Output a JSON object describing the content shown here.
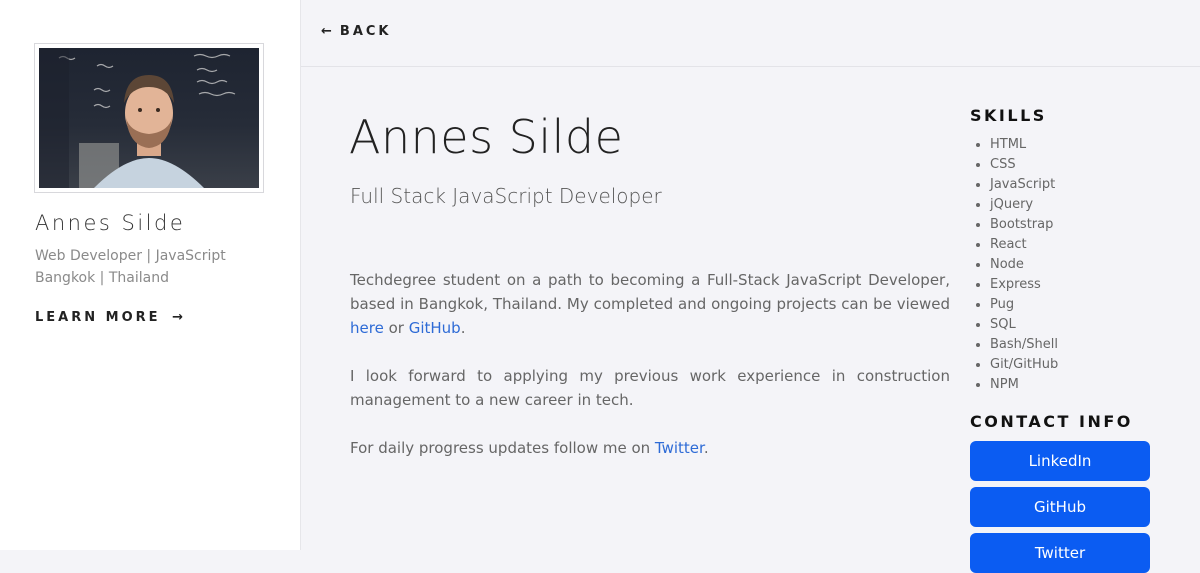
{
  "sidebar": {
    "name": "Annes Silde",
    "role": "Web Developer | JavaScript",
    "location": "Bangkok | Thailand",
    "learn_more_label": "LEARN MORE",
    "learn_more_arrow": "→"
  },
  "topbar": {
    "back_arrow": "←",
    "back_label": "BACK"
  },
  "main": {
    "name": "Annes Silde",
    "title": "Full Stack JavaScript Developer",
    "bio1_text": "Techdegree student on a path to becoming a Full-Stack JavaScript Developer, based in Bangkok, Thailand. My completed and ongoing projects can be viewed ",
    "bio1_link1": "here",
    "bio1_mid": " or ",
    "bio1_link2": "GitHub",
    "bio1_end": ".",
    "bio2_text": "I look forward to applying my previous work experience in construction management to a new career in tech.",
    "bio3_text": "For daily progress updates follow me on ",
    "bio3_link": "Twitter",
    "bio3_end": "."
  },
  "skills": {
    "heading": "SKILLS",
    "items": [
      "HTML",
      "CSS",
      "JavaScript",
      "jQuery",
      "Bootstrap",
      "React",
      "Node",
      "Express",
      "Pug",
      "SQL",
      "Bash/Shell",
      "Git/GitHub",
      "NPM"
    ]
  },
  "contact": {
    "heading": "CONTACT INFO",
    "buttons": [
      "LinkedIn",
      "GitHub",
      "Twitter"
    ]
  },
  "colors": {
    "accent": "#0b5cf2",
    "link": "#2e6bd6",
    "background": "#f4f4f8"
  }
}
